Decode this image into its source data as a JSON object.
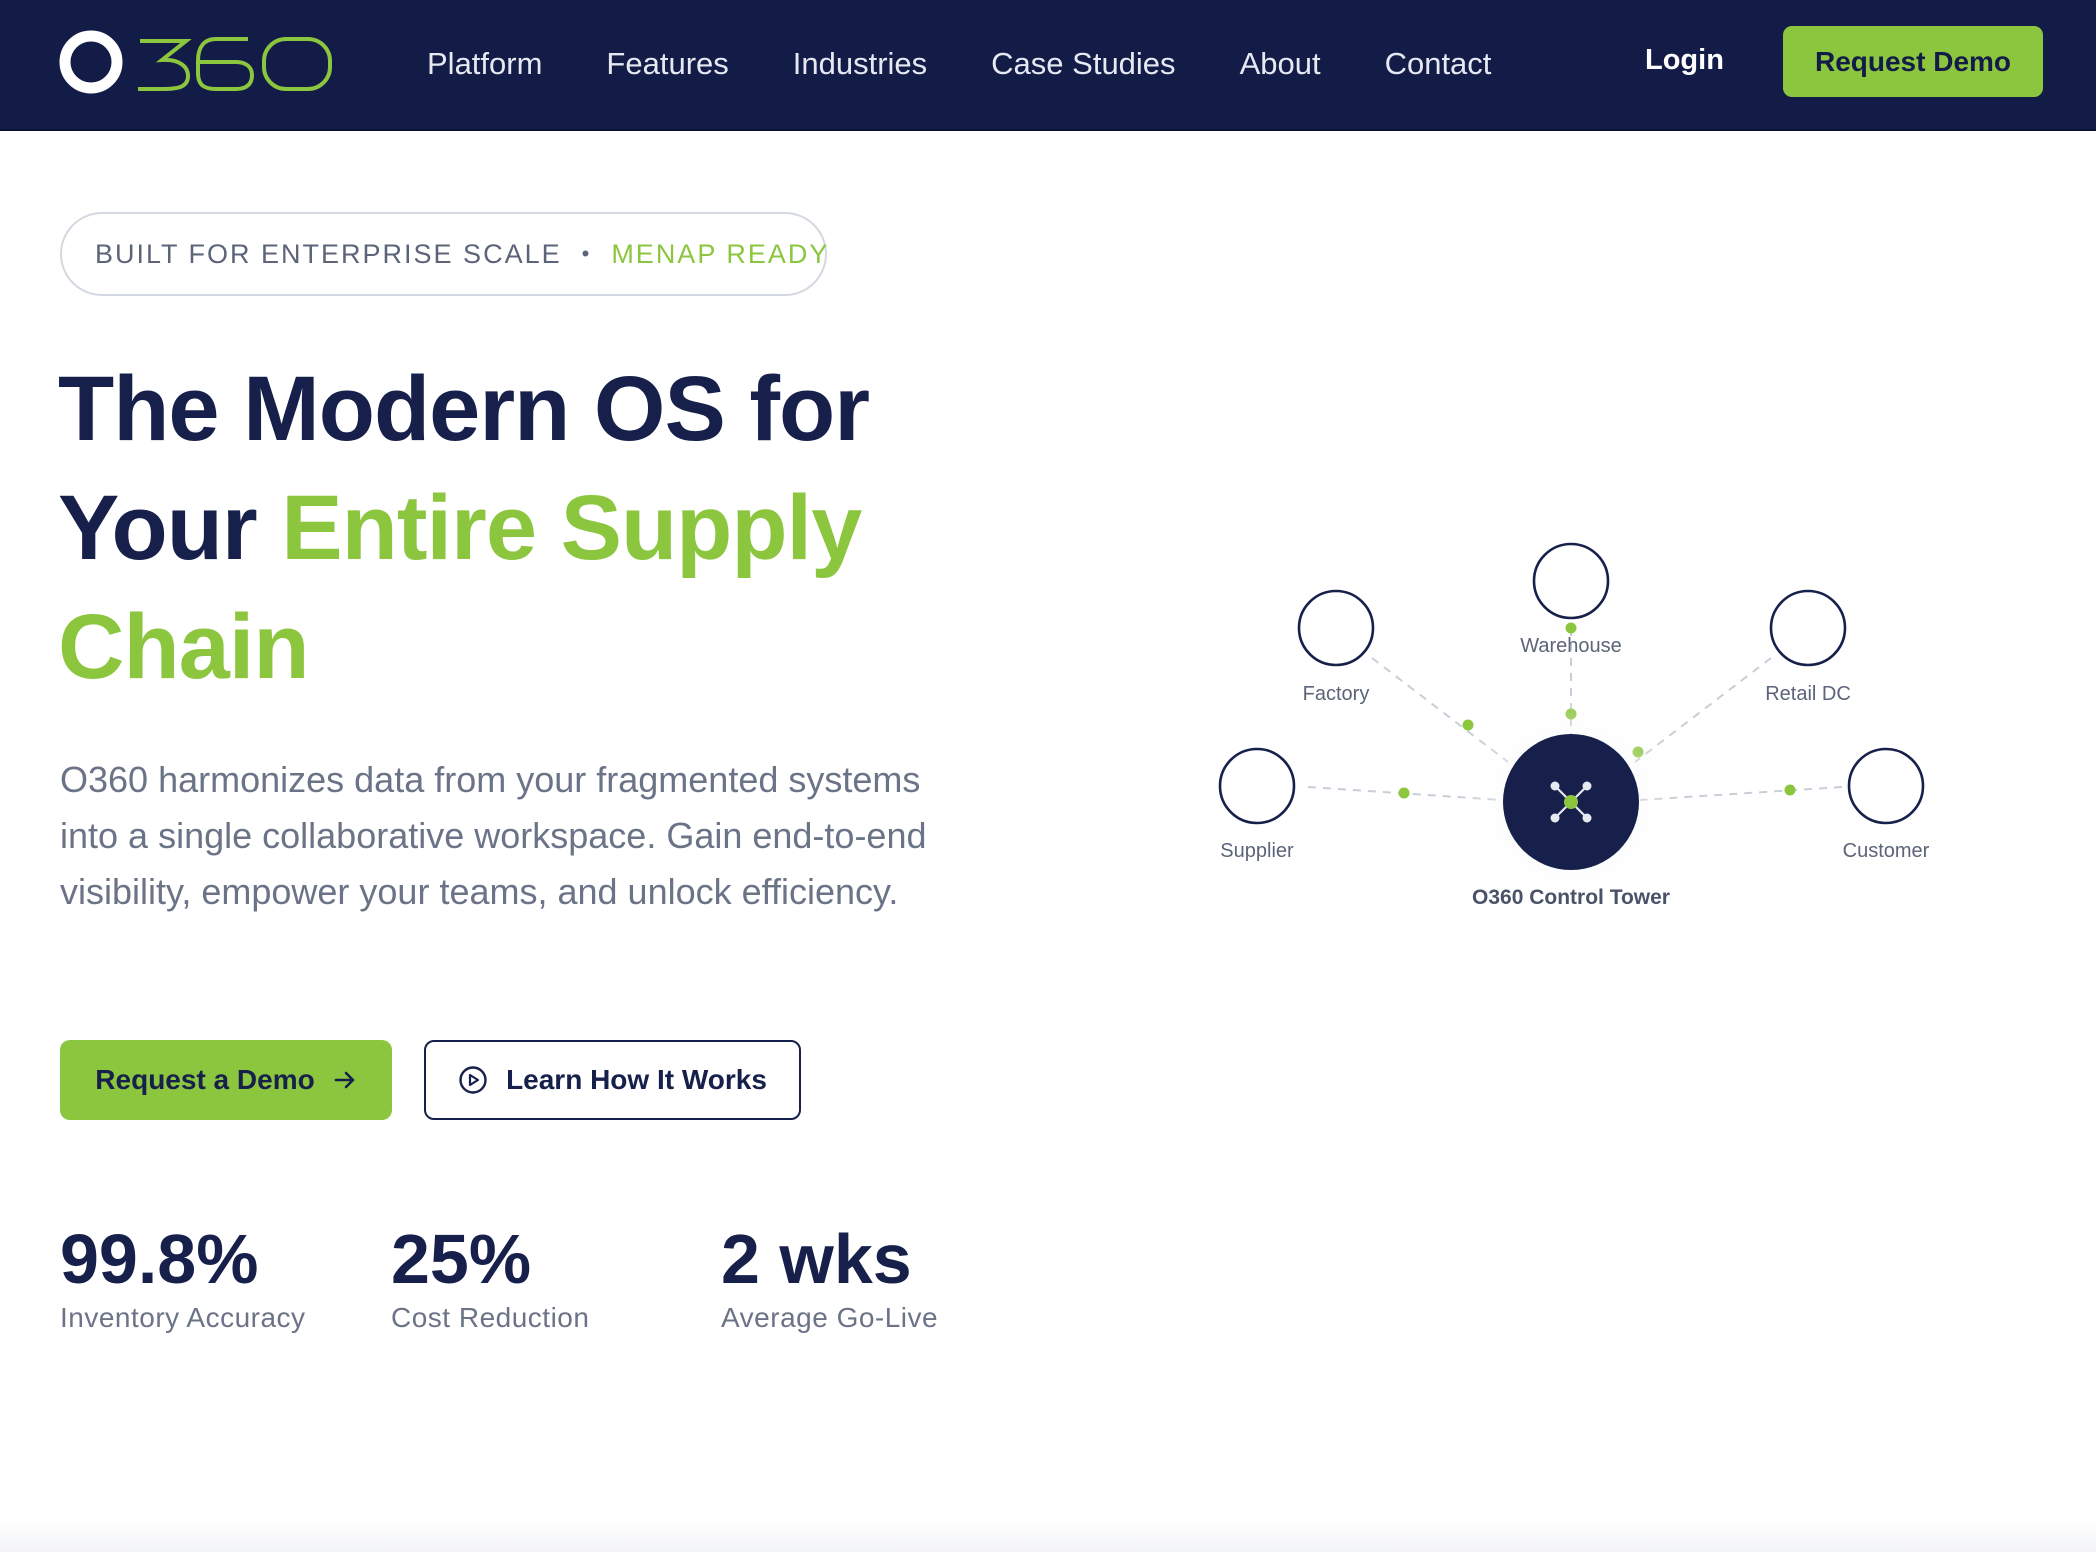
{
  "brand": {
    "name": "O360",
    "accent": "#8cc63f",
    "navy": "#121c47"
  },
  "nav": {
    "items": [
      "Platform",
      "Features",
      "Industries",
      "Case Studies",
      "About",
      "Contact"
    ],
    "login": "Login",
    "cta": "Request Demo"
  },
  "hero": {
    "badge": {
      "left": "BUILT FOR ENTERPRISE SCALE",
      "separator": "•",
      "right": "MENAP READY"
    },
    "headline": {
      "line1": "The Modern OS for",
      "line2_plain": "Your ",
      "line2_accent": "Entire Supply",
      "line3_accent": "Chain"
    },
    "subtext": "O360 harmonizes data from your fragmented systems into a single collaborative workspace. Gain end-to-end visibility, empower your teams, and unlock efficiency.",
    "primary_button": "Request a Demo",
    "secondary_button": "Learn How It Works"
  },
  "stats": [
    {
      "value": "99.8%",
      "label": "Inventory Accuracy"
    },
    {
      "value": "25%",
      "label": "Cost Reduction"
    },
    {
      "value": "2 wks",
      "label": "Average Go-Live"
    }
  ],
  "diagram": {
    "center_label": "O360 Control Tower",
    "nodes": {
      "factory": "Factory",
      "warehouse": "Warehouse",
      "retail": "Retail DC",
      "supplier": "Supplier",
      "customer": "Customer"
    }
  }
}
